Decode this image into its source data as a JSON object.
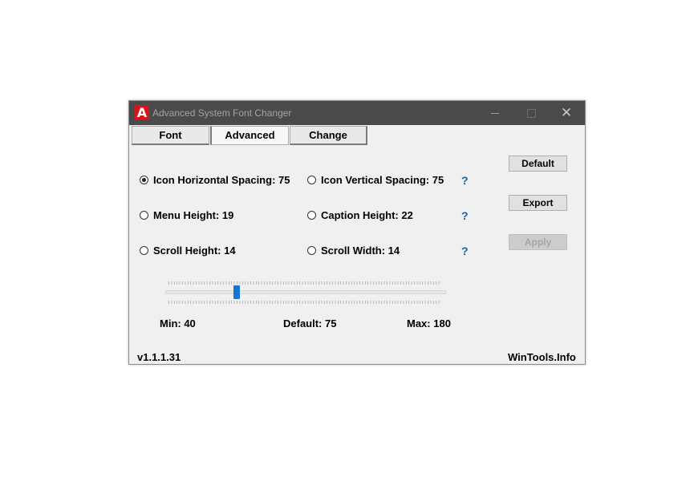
{
  "window": {
    "title": "Advanced System Font Changer",
    "icon_letter": "A",
    "controls": [
      "minimize",
      "maximize",
      "close"
    ]
  },
  "tabs": [
    {
      "label": "Font"
    },
    {
      "label": "Advanced",
      "active": true
    },
    {
      "label": "Change"
    }
  ],
  "options": [
    {
      "label": "Icon Horizontal Spacing: 75",
      "checked": true
    },
    {
      "label": "Icon Vertical Spacing: 75",
      "checked": false
    },
    {
      "label": "Menu Height: 19",
      "checked": false
    },
    {
      "label": "Caption Height: 22",
      "checked": false
    },
    {
      "label": "Scroll Height: 14",
      "checked": false
    },
    {
      "label": "Scroll Width: 14",
      "checked": false
    }
  ],
  "help_mark": "?",
  "buttons": {
    "default": "Default",
    "export": "Export",
    "apply": "Apply"
  },
  "slider": {
    "min": 40,
    "max": 180,
    "value": 75,
    "min_label": "Min: 40",
    "default_label": "Default: 75",
    "max_label": "Max: 180"
  },
  "footer": {
    "version": "v1.1.1.31",
    "site": "WinTools.Info"
  },
  "colors": {
    "titlebar": "#4a4a4a",
    "accent": "#1a73d1",
    "help": "#1a5fb4",
    "brand": "#d8141a"
  }
}
